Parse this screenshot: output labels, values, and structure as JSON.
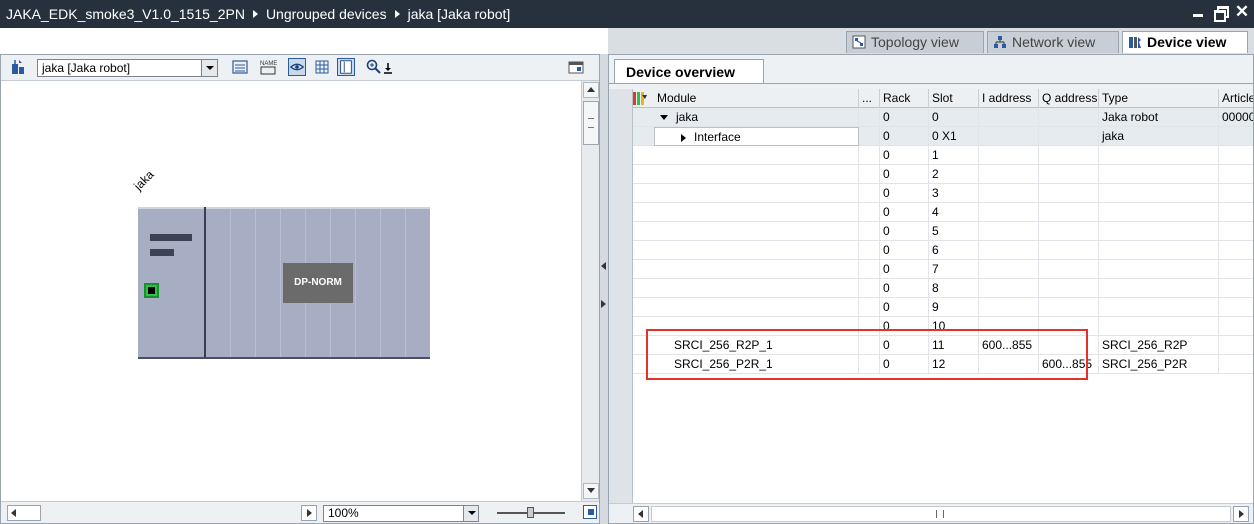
{
  "titlebar": {
    "crumbs": [
      "JAKA_EDK_smoke3_V1.0_1515_2PN",
      "Ungrouped devices",
      "jaka [Jaka robot]"
    ]
  },
  "view_tabs": {
    "topology": "Topology view",
    "network": "Network view",
    "device": "Device view",
    "active": "device"
  },
  "left": {
    "device_select": "jaka [Jaka robot]",
    "device_label": "jaka",
    "module_label": "DP-NORM",
    "zoom": "100%",
    "icons": [
      "add-device-icon",
      "rack-list-icon",
      "name-icon",
      "show-hide-icon",
      "grid-icon",
      "properties-icon",
      "zoom-icon"
    ]
  },
  "right": {
    "overview_tab": "Device overview",
    "columns": [
      "Module",
      "...",
      "Rack",
      "Slot",
      "I address",
      "Q address",
      "Type",
      "Article ..."
    ],
    "rows": [
      {
        "module": "jaka",
        "rack": "0",
        "slot": "0",
        "iaddr": "",
        "qaddr": "",
        "type": "Jaka robot",
        "article": "00000...",
        "level": 0,
        "expand": "down"
      },
      {
        "module": "Interface",
        "rack": "0",
        "slot": "0 X1",
        "iaddr": "",
        "qaddr": "",
        "type": "jaka",
        "article": "",
        "level": 1,
        "expand": "right"
      },
      {
        "module": "",
        "rack": "0",
        "slot": "1",
        "iaddr": "",
        "qaddr": "",
        "type": "",
        "article": ""
      },
      {
        "module": "",
        "rack": "0",
        "slot": "2",
        "iaddr": "",
        "qaddr": "",
        "type": "",
        "article": ""
      },
      {
        "module": "",
        "rack": "0",
        "slot": "3",
        "iaddr": "",
        "qaddr": "",
        "type": "",
        "article": ""
      },
      {
        "module": "",
        "rack": "0",
        "slot": "4",
        "iaddr": "",
        "qaddr": "",
        "type": "",
        "article": ""
      },
      {
        "module": "",
        "rack": "0",
        "slot": "5",
        "iaddr": "",
        "qaddr": "",
        "type": "",
        "article": ""
      },
      {
        "module": "",
        "rack": "0",
        "slot": "6",
        "iaddr": "",
        "qaddr": "",
        "type": "",
        "article": ""
      },
      {
        "module": "",
        "rack": "0",
        "slot": "7",
        "iaddr": "",
        "qaddr": "",
        "type": "",
        "article": ""
      },
      {
        "module": "",
        "rack": "0",
        "slot": "8",
        "iaddr": "",
        "qaddr": "",
        "type": "",
        "article": ""
      },
      {
        "module": "",
        "rack": "0",
        "slot": "9",
        "iaddr": "",
        "qaddr": "",
        "type": "",
        "article": ""
      },
      {
        "module": "",
        "rack": "0",
        "slot": "10",
        "iaddr": "",
        "qaddr": "",
        "type": "",
        "article": ""
      },
      {
        "module": "SRCI_256_R2P_1",
        "rack": "0",
        "slot": "11",
        "iaddr": "600...855",
        "qaddr": "",
        "type": "SRCI_256_R2P",
        "article": ""
      },
      {
        "module": "SRCI_256_P2R_1",
        "rack": "0",
        "slot": "12",
        "iaddr": "",
        "qaddr": "600...855",
        "type": "SRCI_256_P2R",
        "article": ""
      }
    ]
  },
  "colors": {
    "titlebar_bg": "#26313d",
    "highlight": "#e6302c",
    "rack": "#a7adc3",
    "port": "#2ec14a"
  }
}
